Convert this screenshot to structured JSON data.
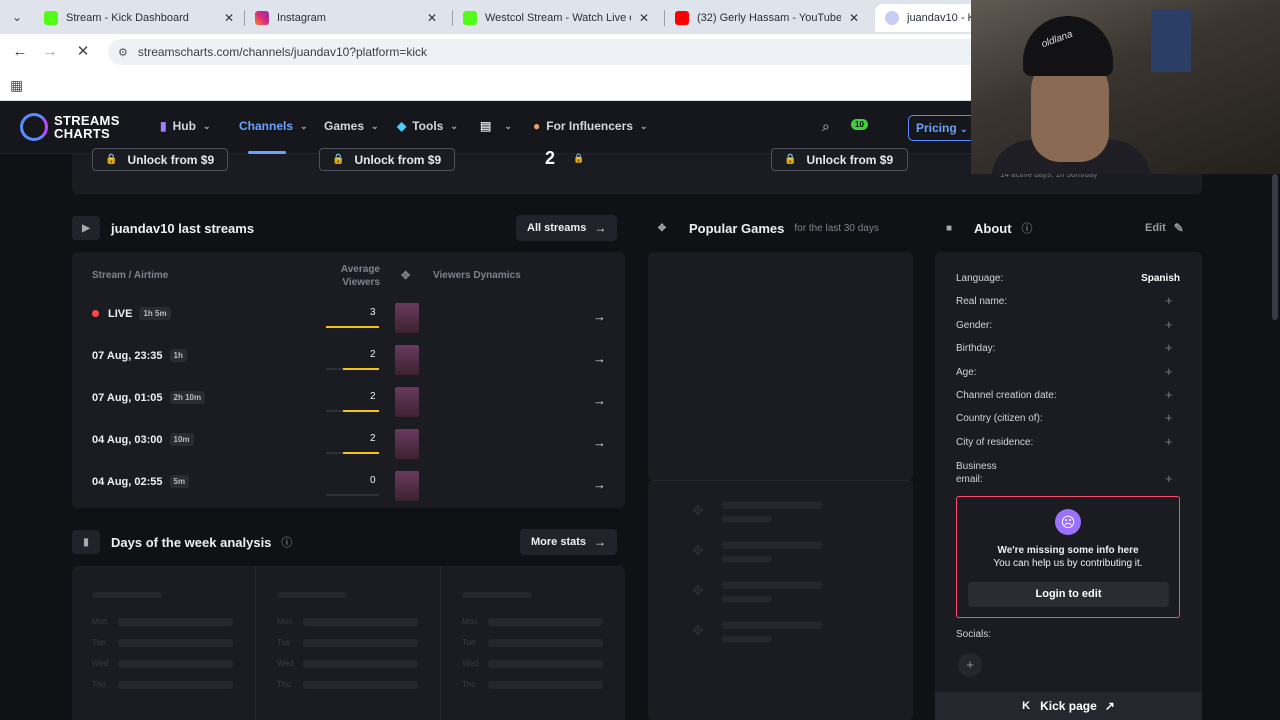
{
  "browser": {
    "tabs": [
      {
        "title": "Stream - Kick Dashboard",
        "favicon": "kick",
        "color": "#53fc18"
      },
      {
        "title": "Instagram",
        "favicon": "instagram",
        "color": "#e1306c"
      },
      {
        "title": "Westcol Stream - Watch Live o",
        "favicon": "kick",
        "color": "#53fc18"
      },
      {
        "title": "(32) Gerly Hassam - YouTube",
        "favicon": "youtube",
        "color": "#ff0000"
      },
      {
        "title": "juandav10 - K",
        "favicon": "streamscharts",
        "color": "#7c8cff"
      }
    ],
    "url": "streamscharts.com/channels/juandav10?platform=kick"
  },
  "site": {
    "logo_line1": "STREAMS",
    "logo_line2": "CHARTS",
    "nav": [
      "Hub",
      "Channels",
      "Games",
      "Tools",
      "",
      "For Influencers"
    ],
    "pricing": "Pricing",
    "badge_count": "10"
  },
  "unlock": {
    "label": "Unlock from $9",
    "number": "2",
    "active_days": "14 active days, 1h 30m/day"
  },
  "streams": {
    "title": "juandav10 last streams",
    "all_btn": "All streams",
    "col_stream": "Stream / Airtime",
    "col_avg": "Average Viewers",
    "col_dyn": "Viewers Dynamics",
    "rows": [
      {
        "date": "LIVE",
        "live": true,
        "duration": "1h 5m",
        "avg": "3",
        "fill": 1.0
      },
      {
        "date": "07 Aug, 23:35",
        "live": false,
        "duration": "1h",
        "avg": "2",
        "fill": 0.67
      },
      {
        "date": "07 Aug, 01:05",
        "live": false,
        "duration": "2h 10m",
        "avg": "2",
        "fill": 0.67
      },
      {
        "date": "04 Aug, 03:00",
        "live": false,
        "duration": "10m",
        "avg": "2",
        "fill": 0.67
      },
      {
        "date": "04 Aug, 02:55",
        "live": false,
        "duration": "5m",
        "avg": "0",
        "fill": 0.0
      }
    ]
  },
  "popular": {
    "title": "Popular Games",
    "subtitle": "for the last 30 days"
  },
  "days": {
    "title": "Days of the week analysis",
    "more_btn": "More stats",
    "day_labels": [
      "Mon",
      "Tue",
      "Wed",
      "Thu"
    ]
  },
  "about": {
    "title": "About",
    "edit": "Edit",
    "rows": [
      {
        "label": "Language:",
        "value": "Spanish"
      },
      {
        "label": "Real name:",
        "value": ""
      },
      {
        "label": "Gender:",
        "value": ""
      },
      {
        "label": "Birthday:",
        "value": ""
      },
      {
        "label": "Age:",
        "value": ""
      },
      {
        "label": "Channel creation date:",
        "value": ""
      },
      {
        "label": "Country (citizen of):",
        "value": ""
      },
      {
        "label": "City of residence:",
        "value": ""
      }
    ],
    "business_label_1": "Business",
    "business_label_2": "email:",
    "missing_1": "We're missing some info here",
    "missing_2": "You can help us by contributing it.",
    "login_btn": "Login to edit",
    "socials": "Socials:",
    "kick_page": "Kick page"
  },
  "webcam": {
    "cap_text": "oldlana"
  }
}
